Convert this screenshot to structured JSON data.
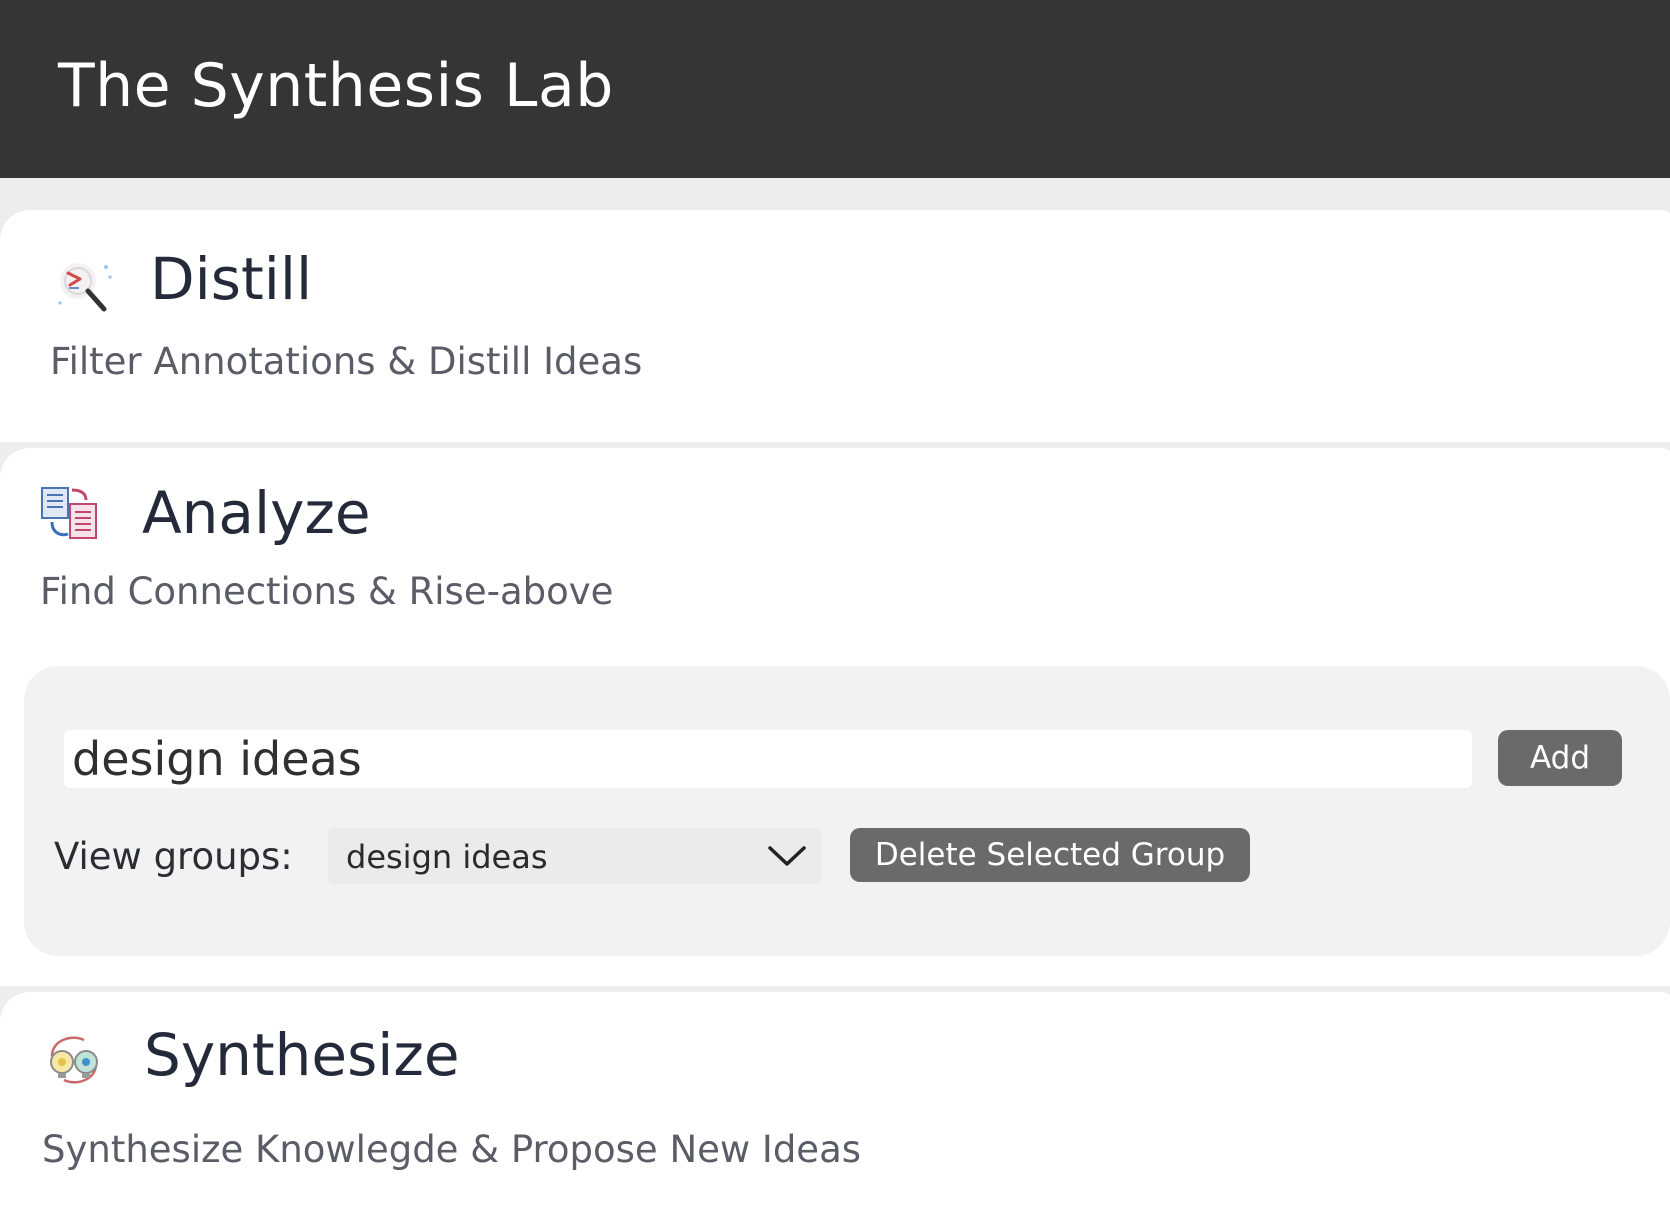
{
  "header": {
    "title": "The Synthesis Lab"
  },
  "sections": {
    "distill": {
      "icon": "magnifier-icon",
      "title": "Distill",
      "subtitle": "Filter Annotations & Distill Ideas"
    },
    "analyze": {
      "icon": "documents-link-icon",
      "title": "Analyze",
      "subtitle": "Find Connections & Rise-above",
      "group_input_value": "design ideas",
      "add_label": "Add",
      "view_groups_label": "View groups:",
      "selected_group": "design ideas",
      "delete_label": "Delete Selected Group"
    },
    "synthesize": {
      "icon": "lightbulbs-cycle-icon",
      "title": "Synthesize",
      "subtitle": "Synthesize Knowlegde & Propose New Ideas"
    }
  },
  "colors": {
    "header_bg": "#353535",
    "page_bg": "#ededed",
    "button_bg": "#6a6a6a",
    "panel_bg": "#f2f2f2"
  }
}
